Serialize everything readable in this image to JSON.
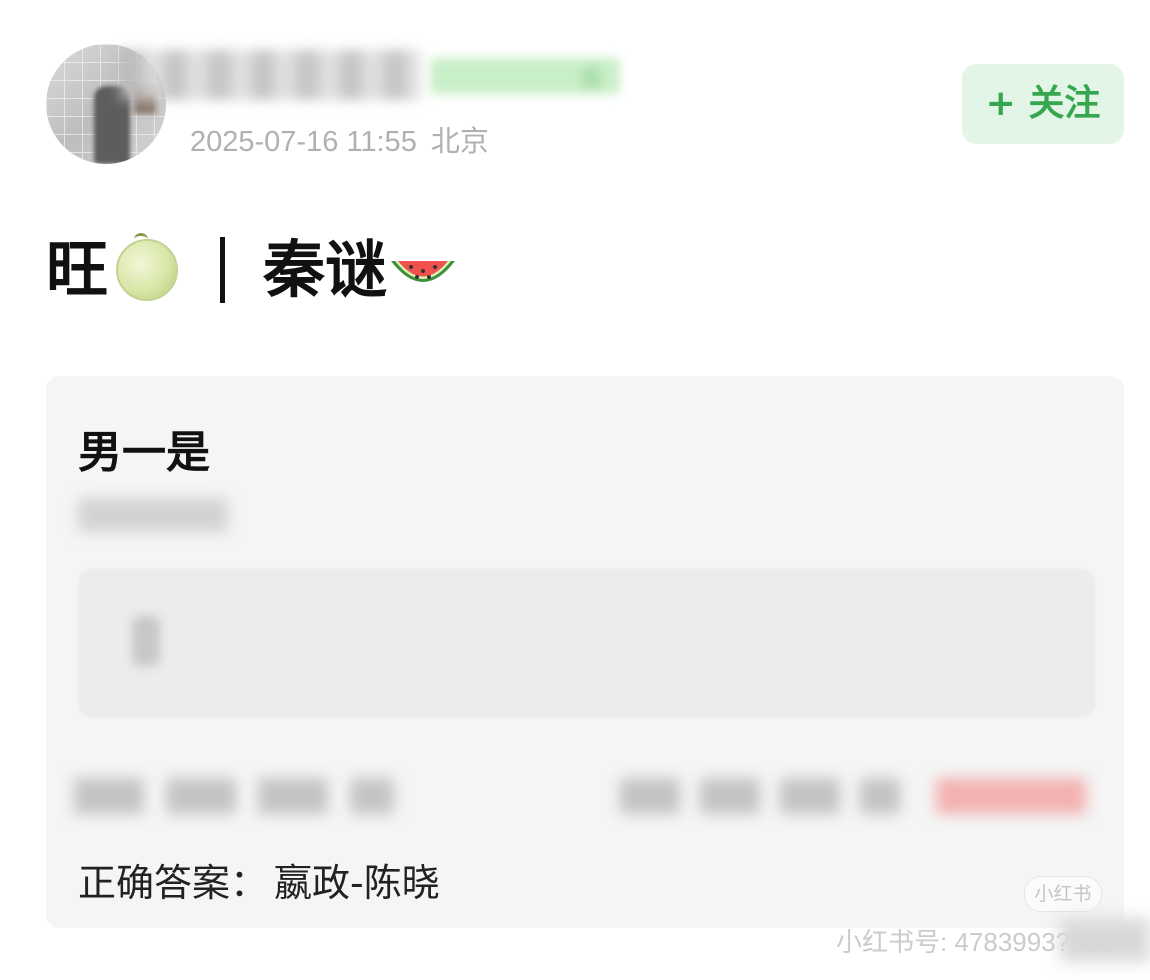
{
  "header": {
    "date": "2025-07-16 11:55",
    "location": "北京",
    "tag_visible_tail": "瓜",
    "follow_label": "+ 关注"
  },
  "post": {
    "title_left": "旺",
    "title_right": "秦谜"
  },
  "quiz": {
    "question": "男一是",
    "answer_label": "正确答案：",
    "answer_value": "嬴政-陈晓"
  },
  "watermarks": {
    "app_logo": "小红书",
    "weibo_id": "小红书号: 4783993?920"
  },
  "icons": [
    "melon-emoji-icon",
    "watermelon-emoji-icon"
  ],
  "colors": {
    "follow_text": "#36a64f",
    "follow_bg": "#e3f5e6"
  }
}
